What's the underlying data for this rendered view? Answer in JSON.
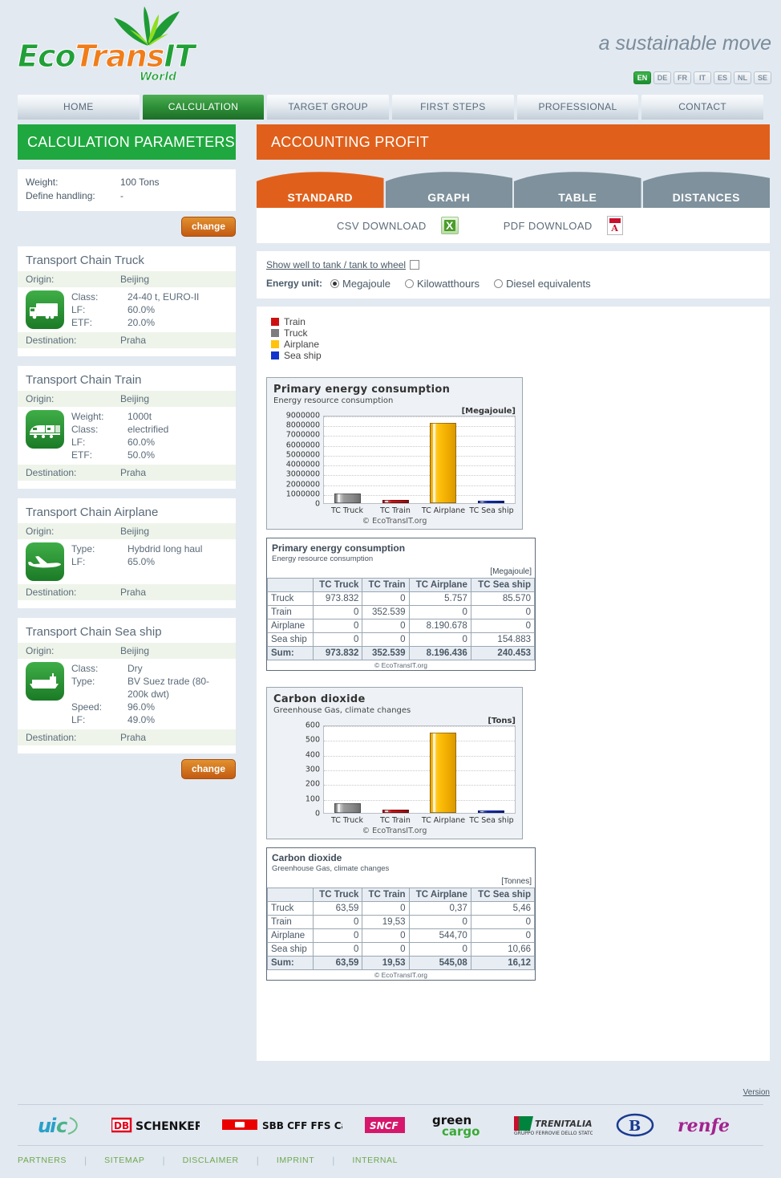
{
  "brand": {
    "logo_eco": "Eco",
    "logo_trans": "Trans",
    "logo_it": "IT",
    "logo_world": "World",
    "tagline": "a sustainable move"
  },
  "languages": {
    "items": [
      "EN",
      "DE",
      "FR",
      "IT",
      "ES",
      "NL",
      "SE"
    ],
    "active": "EN"
  },
  "nav": {
    "items": [
      {
        "label": "HOME",
        "active": false
      },
      {
        "label": "CALCULATION",
        "active": true
      },
      {
        "label": "TARGET GROUP",
        "active": false
      },
      {
        "label": "FIRST STEPS",
        "active": false
      },
      {
        "label": "PROFESSIONAL",
        "active": false
      },
      {
        "label": "CONTACT",
        "active": false
      }
    ]
  },
  "sidebar": {
    "title": "CALCULATION PARAMETERS",
    "general": {
      "rows": [
        {
          "key": "Weight:",
          "value": "100 Tons"
        },
        {
          "key": "Define handling:",
          "value": "-"
        }
      ],
      "change_label": "change"
    },
    "change_label_bottom": "change",
    "origin_label": "Origin:",
    "destination_label": "Destination:",
    "chains": [
      {
        "title": "Transport Chain Truck",
        "icon": "truck-icon",
        "origin": "Beijing",
        "destination": "Praha",
        "specs": [
          {
            "key": "Class:",
            "value": "24-40 t, EURO-II"
          },
          {
            "key": "LF:",
            "value": "60.0%"
          },
          {
            "key": "ETF:",
            "value": "20.0%"
          }
        ]
      },
      {
        "title": "Transport Chain Train",
        "icon": "train-icon",
        "origin": "Beijing",
        "destination": "Praha",
        "specs": [
          {
            "key": "Weight:",
            "value": "1000t"
          },
          {
            "key": "Class:",
            "value": "electrified"
          },
          {
            "key": "LF:",
            "value": "60.0%"
          },
          {
            "key": "ETF:",
            "value": "50.0%"
          }
        ]
      },
      {
        "title": "Transport Chain Airplane",
        "icon": "airplane-icon",
        "origin": "Beijing",
        "destination": "Praha",
        "specs": [
          {
            "key": "Type:",
            "value": "Hybdrid long haul"
          },
          {
            "key": "LF:",
            "value": "65.0%"
          }
        ]
      },
      {
        "title": "Transport Chain Sea ship",
        "icon": "seaship-icon",
        "origin": "Beijing",
        "destination": "Praha",
        "specs": [
          {
            "key": "Class:",
            "value": "Dry"
          },
          {
            "key": "Type:",
            "value": "BV Suez trade (80-200k dwt)"
          },
          {
            "key": "Speed:",
            "value": "96.0%"
          },
          {
            "key": "LF:",
            "value": "49.0%"
          }
        ]
      }
    ]
  },
  "results": {
    "title": "ACCOUNTING PROFIT",
    "tabs": [
      {
        "label": "STANDARD",
        "active": true
      },
      {
        "label": "GRAPH",
        "active": false
      },
      {
        "label": "TABLE",
        "active": false
      },
      {
        "label": "DISTANCES",
        "active": false
      }
    ],
    "downloads": {
      "csv_label": "CSV DOWNLOAD",
      "csv_icon": "excel-icon",
      "pdf_label": "PDF DOWNLOAD",
      "pdf_icon": "pdf-icon"
    },
    "options": {
      "wtt_link": "Show well to tank / tank to wheel",
      "wtt_checked": false,
      "energy_unit_label": "Energy unit:",
      "energy_units": [
        {
          "label": "Megajoule",
          "selected": true
        },
        {
          "label": "Kilowatthours",
          "selected": false
        },
        {
          "label": "Diesel equivalents",
          "selected": false
        }
      ]
    },
    "legend": [
      {
        "label": "Train",
        "color": "#cc1111"
      },
      {
        "label": "Truck",
        "color": "#7d7d7d"
      },
      {
        "label": "Airplane",
        "color": "#ffc20e"
      },
      {
        "label": "Sea ship",
        "color": "#1133cc"
      }
    ]
  },
  "chart_data": [
    {
      "type": "bar",
      "title": "Primary energy consumption",
      "subtitle": "Energy resource consumption",
      "unit": "[Megajoule]",
      "credit": "© EcoTransIT.org",
      "categories": [
        "TC Truck",
        "TC Train",
        "TC Airplane",
        "TC Sea ship"
      ],
      "values": [
        973832,
        352539,
        8196436,
        240453
      ],
      "colors": [
        "#8a8a8a",
        "#cc1111",
        "#ffc20e",
        "#1133cc"
      ],
      "ylim": [
        0,
        9000000
      ],
      "yticks": [
        0,
        1000000,
        2000000,
        3000000,
        4000000,
        5000000,
        6000000,
        7000000,
        8000000,
        9000000
      ],
      "ytick_labels": [
        "0",
        "1000000",
        "2000000",
        "3000000",
        "4000000",
        "5000000",
        "6000000",
        "7000000",
        "8000000",
        "9000000"
      ],
      "grid": true,
      "legend_position": "above"
    },
    {
      "type": "bar",
      "title": "Carbon dioxide",
      "subtitle": "Greenhouse Gas, climate changes",
      "unit": "[Tons]",
      "credit": "© EcoTransIT.org",
      "categories": [
        "TC Truck",
        "TC Train",
        "TC Airplane",
        "TC Sea ship"
      ],
      "values": [
        63.59,
        19.53,
        545.08,
        16.12
      ],
      "colors": [
        "#8a8a8a",
        "#cc1111",
        "#ffc20e",
        "#1133cc"
      ],
      "ylim": [
        0,
        600
      ],
      "yticks": [
        0,
        100,
        200,
        300,
        400,
        500,
        600
      ],
      "ytick_labels": [
        "0",
        "100",
        "200",
        "300",
        "400",
        "500",
        "600"
      ],
      "grid": true,
      "legend_position": "above"
    }
  ],
  "tables": [
    {
      "title": "Primary energy consumption",
      "subtitle": "Energy resource consumption",
      "unit": "[Megajoule]",
      "credit": "© EcoTransIT.org",
      "columns": [
        "",
        "TC Truck",
        "TC Train",
        "TC Airplane",
        "TC Sea ship"
      ],
      "rows": [
        {
          "label": "Truck",
          "cells": [
            "973.832",
            "0",
            "5.757",
            "85.570"
          ]
        },
        {
          "label": "Train",
          "cells": [
            "0",
            "352.539",
            "0",
            "0"
          ]
        },
        {
          "label": "Airplane",
          "cells": [
            "0",
            "0",
            "8.190.678",
            "0"
          ]
        },
        {
          "label": "Sea ship",
          "cells": [
            "0",
            "0",
            "0",
            "154.883"
          ]
        }
      ],
      "sum": {
        "label": "Sum:",
        "cells": [
          "973.832",
          "352.539",
          "8.196.436",
          "240.453"
        ]
      }
    },
    {
      "title": "Carbon dioxide",
      "subtitle": "Greenhouse Gas, climate changes",
      "unit": "[Tonnes]",
      "credit": "© EcoTransIT.org",
      "columns": [
        "",
        "TC Truck",
        "TC Train",
        "TC Airplane",
        "TC Sea ship"
      ],
      "rows": [
        {
          "label": "Truck",
          "cells": [
            "63,59",
            "0",
            "0,37",
            "5,46"
          ]
        },
        {
          "label": "Train",
          "cells": [
            "0",
            "19,53",
            "0",
            "0"
          ]
        },
        {
          "label": "Airplane",
          "cells": [
            "0",
            "0",
            "544,70",
            "0"
          ]
        },
        {
          "label": "Sea ship",
          "cells": [
            "0",
            "0",
            "0",
            "10,66"
          ]
        }
      ],
      "sum": {
        "label": "Sum:",
        "cells": [
          "63,59",
          "19,53",
          "545,08",
          "16,12"
        ]
      }
    }
  ],
  "footer": {
    "version_label": "Version",
    "partners": [
      "UIC",
      "DB SCHENKER",
      "SBB CFF FFS Cargo",
      "SNCF",
      "green cargo",
      "TRENITALIA GRUPPO FERROVIE DELLO STATO",
      "B",
      "renfe"
    ],
    "links": [
      "PARTNERS",
      "SITEMAP",
      "DISCLAIMER",
      "IMPRINT",
      "INTERNAL"
    ]
  }
}
